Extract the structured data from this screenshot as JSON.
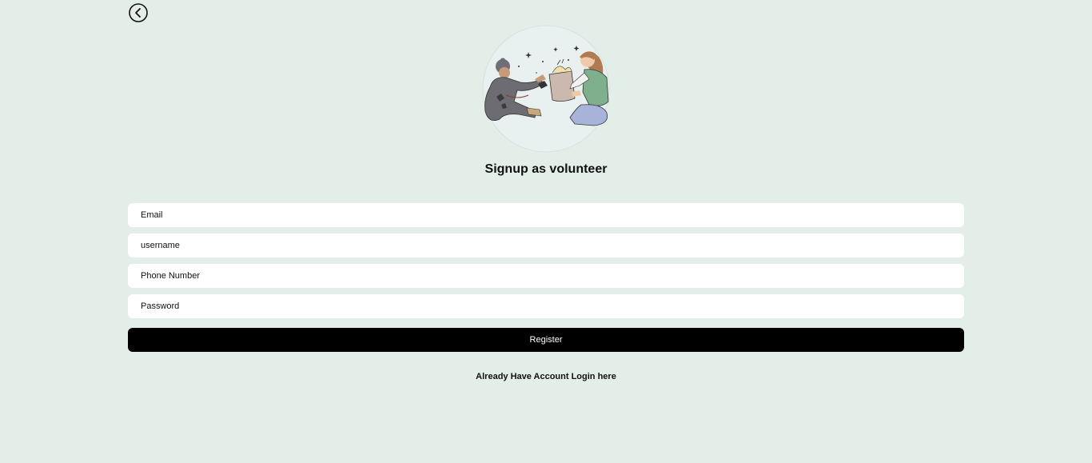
{
  "header": {
    "back_icon": "chevron-left-circle-icon"
  },
  "hero": {
    "illustration": "volunteer-giving-bag-illustration"
  },
  "form": {
    "title": "Signup as volunteer",
    "email_placeholder": "Email",
    "username_placeholder": "username",
    "phone_placeholder": "Phone Number",
    "password_placeholder": "Password",
    "register_label": "Register"
  },
  "footer": {
    "login_link": "Already Have Account Login here"
  },
  "colors": {
    "background": "#e4eee9",
    "button": "#000000",
    "button_text": "#ffffff",
    "field_bg": "#ffffff"
  }
}
